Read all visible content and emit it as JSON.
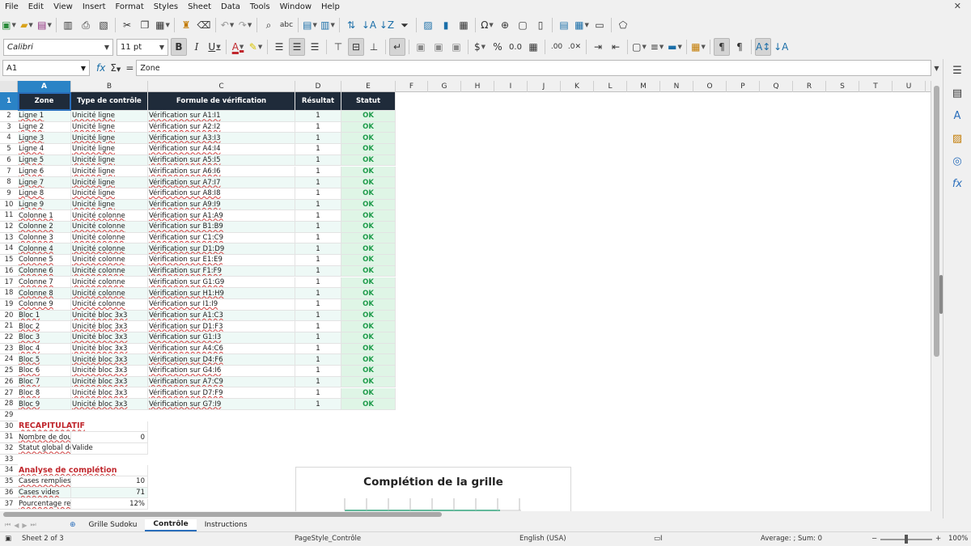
{
  "menu": [
    "File",
    "Edit",
    "View",
    "Insert",
    "Format",
    "Styles",
    "Sheet",
    "Data",
    "Tools",
    "Window",
    "Help"
  ],
  "font": {
    "name": "Calibri",
    "size": "11 pt"
  },
  "formula_bar": {
    "cell_ref": "A1",
    "content": "Zone"
  },
  "columns": [
    "A",
    "B",
    "C",
    "D",
    "E",
    "F",
    "G",
    "H",
    "I",
    "J",
    "K",
    "L",
    "M",
    "N",
    "O",
    "P",
    "Q",
    "R",
    "S",
    "T",
    "U"
  ],
  "rows": [
    "1",
    "2",
    "3",
    "4",
    "5",
    "6",
    "7",
    "8",
    "9",
    "10",
    "11",
    "12",
    "13",
    "14",
    "15",
    "16",
    "17",
    "18",
    "19",
    "20",
    "21",
    "22",
    "23",
    "24",
    "25",
    "26",
    "27",
    "28",
    "29",
    "30",
    "31",
    "32",
    "33",
    "34",
    "35",
    "36",
    "37"
  ],
  "table": {
    "headers": [
      "Zone",
      "Type de contrôle",
      "Formule de vérification",
      "Résultat",
      "Statut"
    ],
    "rows": [
      [
        "Ligne 1",
        "Unicité ligne",
        "Vérification sur A1:I1",
        "1",
        "OK"
      ],
      [
        "Ligne 2",
        "Unicité ligne",
        "Vérification sur A2:I2",
        "1",
        "OK"
      ],
      [
        "Ligne 3",
        "Unicité ligne",
        "Vérification sur A3:I3",
        "1",
        "OK"
      ],
      [
        "Ligne 4",
        "Unicité ligne",
        "Vérification sur A4:I4",
        "1",
        "OK"
      ],
      [
        "Ligne 5",
        "Unicité ligne",
        "Vérification sur A5:I5",
        "1",
        "OK"
      ],
      [
        "Ligne 6",
        "Unicité ligne",
        "Vérification sur A6:I6",
        "1",
        "OK"
      ],
      [
        "Ligne 7",
        "Unicité ligne",
        "Vérification sur A7:I7",
        "1",
        "OK"
      ],
      [
        "Ligne 8",
        "Unicité ligne",
        "Vérification sur A8:I8",
        "1",
        "OK"
      ],
      [
        "Ligne 9",
        "Unicité ligne",
        "Vérification sur A9:I9",
        "1",
        "OK"
      ],
      [
        "Colonne 1",
        "Unicité colonne",
        "Vérification sur A1:A9",
        "1",
        "OK"
      ],
      [
        "Colonne 2",
        "Unicité colonne",
        "Vérification sur B1:B9",
        "1",
        "OK"
      ],
      [
        "Colonne 3",
        "Unicité colonne",
        "Vérification sur C1:C9",
        "1",
        "OK"
      ],
      [
        "Colonne 4",
        "Unicité colonne",
        "Vérification sur D1:D9",
        "1",
        "OK"
      ],
      [
        "Colonne 5",
        "Unicité colonne",
        "Vérification sur E1:E9",
        "1",
        "OK"
      ],
      [
        "Colonne 6",
        "Unicité colonne",
        "Vérification sur F1:F9",
        "1",
        "OK"
      ],
      [
        "Colonne 7",
        "Unicité colonne",
        "Vérification sur G1:G9",
        "1",
        "OK"
      ],
      [
        "Colonne 8",
        "Unicité colonne",
        "Vérification sur H1:H9",
        "1",
        "OK"
      ],
      [
        "Colonne 9",
        "Unicité colonne",
        "Vérification sur I1:I9",
        "1",
        "OK"
      ],
      [
        "Bloc 1",
        "Unicité bloc 3x3",
        "Vérification sur A1:C3",
        "1",
        "OK"
      ],
      [
        "Bloc 2",
        "Unicité bloc 3x3",
        "Vérification sur D1:F3",
        "1",
        "OK"
      ],
      [
        "Bloc 3",
        "Unicité bloc 3x3",
        "Vérification sur G1:I3",
        "1",
        "OK"
      ],
      [
        "Bloc 4",
        "Unicité bloc 3x3",
        "Vérification sur A4:C6",
        "1",
        "OK"
      ],
      [
        "Bloc 5",
        "Unicité bloc 3x3",
        "Vérification sur D4:F6",
        "1",
        "OK"
      ],
      [
        "Bloc 6",
        "Unicité bloc 3x3",
        "Vérification sur G4:I6",
        "1",
        "OK"
      ],
      [
        "Bloc 7",
        "Unicité bloc 3x3",
        "Vérification sur A7:C9",
        "1",
        "OK"
      ],
      [
        "Bloc 8",
        "Unicité bloc 3x3",
        "Vérification sur D7:F9",
        "1",
        "OK"
      ],
      [
        "Bloc 9",
        "Unicité bloc 3x3",
        "Vérification sur G7:I9",
        "1",
        "OK"
      ]
    ]
  },
  "summary": {
    "title": "RÉCAPITULATIF",
    "duplicates_label": "Nombre de dou",
    "duplicates_value": "0",
    "global_label": "Statut global de",
    "global_value": "Valide"
  },
  "completion": {
    "title": "Analyse de complétion",
    "filled_label": "Cases remplies",
    "filled_value": "10",
    "empty_label": "Cases vides",
    "empty_value": "71",
    "percent_label": "Pourcentage re",
    "percent_value": "12%"
  },
  "chart_data": {
    "type": "bar",
    "title": "Complétion de la grille",
    "categories": [],
    "values": []
  },
  "tabs": [
    "Grille Sudoku",
    "Contrôle",
    "Instructions"
  ],
  "active_tab": "Contrôle",
  "status": {
    "sheet": "Sheet 2 of 3",
    "page_style": "PageStyle_Contrôle",
    "language": "English (USA)",
    "sum": "Average: ; Sum: 0",
    "zoom": "100%"
  },
  "colors": {
    "header_bg": "#1f2b3a",
    "ok_text": "#1f9b4b",
    "ok_bg": "#dff5e6",
    "zebra": "#eef9f6",
    "accent": "#2a83c6",
    "section_title": "#c0272d"
  }
}
